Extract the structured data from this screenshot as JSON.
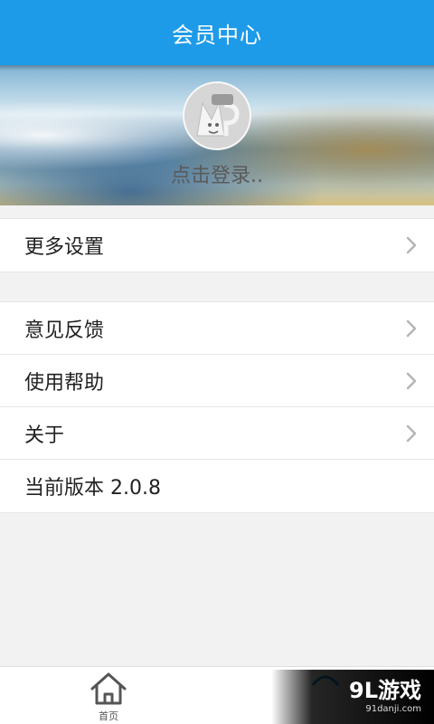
{
  "header": {
    "title": "会员中心"
  },
  "profile": {
    "avatar_icon": "user-avatar-placeholder",
    "avatar_badge_text": "",
    "login_prompt": "点击登录.."
  },
  "menu": {
    "settings": {
      "label": "更多设置"
    },
    "feedback": {
      "label": "意见反馈"
    },
    "help": {
      "label": "使用帮助"
    },
    "about": {
      "label": "关于"
    },
    "version": {
      "label": "当前版本 2.0.8"
    }
  },
  "tabbar": {
    "home": {
      "label": "首页",
      "icon": "home-icon"
    },
    "second": {
      "label": "",
      "icon": "member-icon"
    }
  },
  "watermark": {
    "text": "9L游戏",
    "sub": "91danji.com"
  },
  "colors": {
    "header_bg": "#1e9be8",
    "page_bg": "#f2f2f2",
    "chevron": "#b5b5b5"
  }
}
